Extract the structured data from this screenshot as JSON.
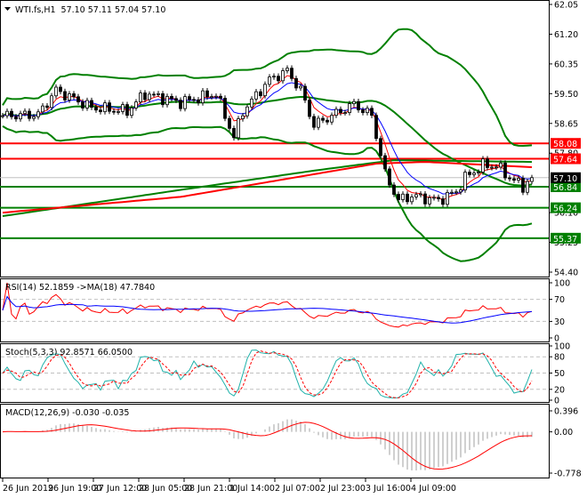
{
  "title": "WTI.fs,H1",
  "ohlc": "57.10 57.11 57.04 57.10",
  "chart_data": {
    "type": "candlestick",
    "symbol": "WTI.fs",
    "timeframe": "H1",
    "ylim": [
      54.4,
      62.05
    ],
    "price_ticks": [
      "62.05",
      "61.20",
      "60.35",
      "59.50",
      "58.65",
      "57.80",
      "56.10",
      "55.25",
      "54.40"
    ],
    "time_labels": [
      "26 Jun 2019",
      "26 Jun 19:00",
      "27 Jun 12:00",
      "28 Jun 05:00",
      "28 Jun 21:00",
      "1 Jul 14:00",
      "2 Jul 07:00",
      "2 Jul 23:00",
      "3 Jul 16:00",
      "4 Jul 09:00"
    ],
    "bar_count": 120,
    "close_keypoints": [
      [
        0,
        58.87
      ],
      [
        8,
        58.9
      ],
      [
        12,
        59.6
      ],
      [
        20,
        59.1
      ],
      [
        28,
        59.0
      ],
      [
        32,
        59.5
      ],
      [
        40,
        59.25
      ],
      [
        48,
        59.5
      ],
      [
        52,
        58.25
      ],
      [
        54,
        59.0
      ],
      [
        60,
        59.9
      ],
      [
        64,
        60.15
      ],
      [
        67,
        59.6
      ],
      [
        70,
        58.6
      ],
      [
        74,
        58.87
      ],
      [
        79,
        59.2
      ],
      [
        83,
        58.87
      ],
      [
        86,
        57.2
      ],
      [
        89,
        56.45
      ],
      [
        92,
        56.58
      ],
      [
        98,
        56.45
      ],
      [
        102,
        56.7
      ],
      [
        104,
        57.1
      ],
      [
        108,
        57.45
      ],
      [
        111,
        57.45
      ],
      [
        114,
        57.1
      ],
      [
        117,
        56.85
      ],
      [
        119,
        57.1
      ]
    ],
    "ma_slow_keypoints": [
      [
        0,
        56.1
      ],
      [
        40,
        56.55
      ],
      [
        84,
        57.5
      ],
      [
        95,
        57.55
      ],
      [
        119,
        57.4
      ]
    ],
    "ma_mid_keypoints": [
      [
        0,
        56.0
      ],
      [
        40,
        56.75
      ],
      [
        70,
        57.3
      ],
      [
        88,
        57.6
      ],
      [
        119,
        57.55
      ]
    ],
    "levels": [
      {
        "price": 58.08,
        "label": "58.08",
        "color": "#ff0000"
      },
      {
        "price": 57.64,
        "label": "57.64",
        "color": "#ff0000"
      },
      {
        "price": 56.84,
        "label": "56.84",
        "color": "#008000"
      },
      {
        "price": 56.24,
        "label": "56.24",
        "color": "#008000"
      },
      {
        "price": 55.37,
        "label": "55.37",
        "color": "#008000"
      }
    ],
    "current_price": {
      "price": 57.1,
      "label": "57.10"
    },
    "rsi": {
      "label": "RSI(14) 52.1859  ->MA(18) 47.7840",
      "ticks": [
        "100",
        "70",
        "30",
        "0"
      ]
    },
    "stoch": {
      "label": "Stoch(5,3,3) 92.8571 66.0500",
      "ticks": [
        "100",
        "80",
        "50",
        "20",
        "0"
      ]
    },
    "macd": {
      "label": "MACD(12,26,9) -0.030 -0.035",
      "ticks": [
        "0.396",
        "0.00",
        "-0.778"
      ],
      "ylim": [
        -0.778,
        0.396
      ]
    }
  }
}
